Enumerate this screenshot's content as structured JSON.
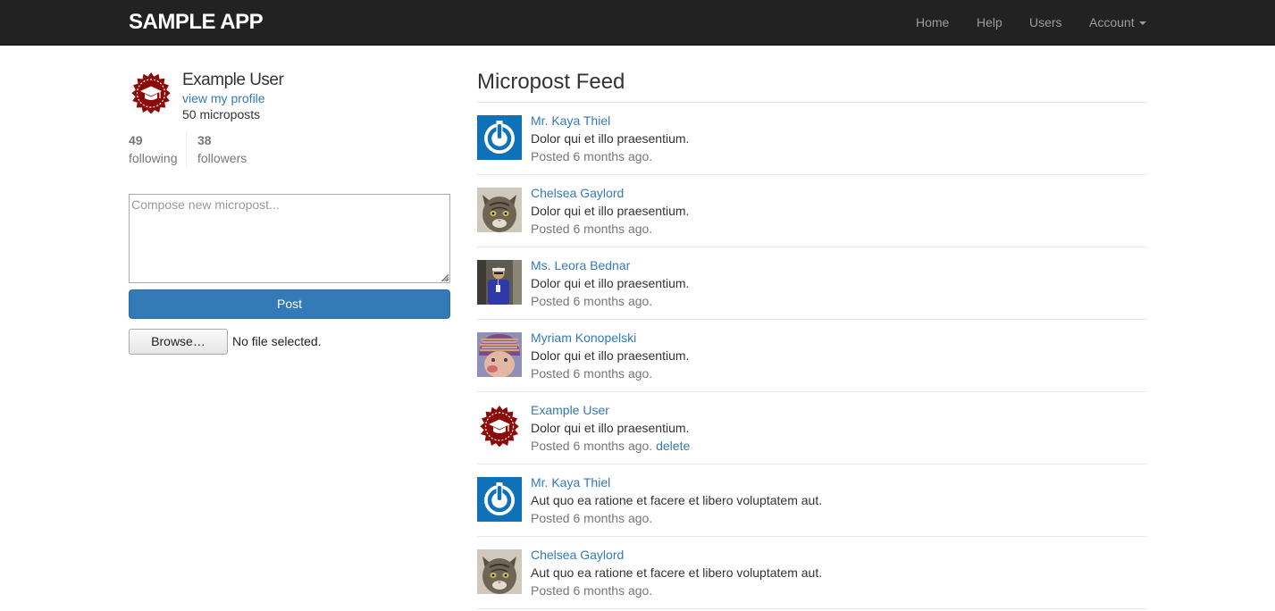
{
  "header": {
    "brand": "SAMPLE APP",
    "nav": {
      "home": "Home",
      "help": "Help",
      "users": "Users",
      "account": "Account"
    }
  },
  "user": {
    "name": "Example User",
    "profile_link": "view my profile",
    "micropost_count": "50 microposts",
    "stats": {
      "following_count": "49",
      "following_label": "following",
      "followers_count": "38",
      "followers_label": "followers"
    }
  },
  "compose": {
    "placeholder": "Compose new micropost...",
    "post_label": "Post",
    "browse_label": "Browse…",
    "file_status": "No file selected."
  },
  "feed": {
    "title": "Micropost Feed",
    "items": [
      {
        "user": "Mr. Kaya Thiel",
        "content": "Dolor qui et illo praesentium.",
        "timestamp": "Posted 6 months ago.",
        "delete": "",
        "avatar": "power-avatar"
      },
      {
        "user": "Chelsea Gaylord",
        "content": "Dolor qui et illo praesentium.",
        "timestamp": "Posted 6 months ago.",
        "delete": "",
        "avatar": "cat-avatar"
      },
      {
        "user": "Ms. Leora Bednar",
        "content": "Dolor qui et illo praesentium.",
        "timestamp": "Posted 6 months ago.",
        "delete": "",
        "avatar": "person-avatar"
      },
      {
        "user": "Myriam Konopelski",
        "content": "Dolor qui et illo praesentium.",
        "timestamp": "Posted 6 months ago.",
        "delete": "",
        "avatar": "baby-avatar"
      },
      {
        "user": "Example User",
        "content": "Dolor qui et illo praesentium.",
        "timestamp": "Posted 6 months ago.",
        "delete": "delete",
        "avatar": "graduation-badge-avatar"
      },
      {
        "user": "Mr. Kaya Thiel",
        "content": "Aut quo ea ratione et facere et libero voluptatem aut.",
        "timestamp": "Posted 6 months ago.",
        "delete": "",
        "avatar": "power-avatar"
      },
      {
        "user": "Chelsea Gaylord",
        "content": "Aut quo ea ratione et facere et libero voluptatem aut.",
        "timestamp": "Posted 6 months ago.",
        "delete": "",
        "avatar": "cat-avatar"
      }
    ]
  },
  "colors": {
    "navbar": "#222222",
    "link": "#337ab7",
    "primary_button": "#337ab7",
    "badge": "#8b0a0a",
    "power_blue": "#0f72b8"
  }
}
